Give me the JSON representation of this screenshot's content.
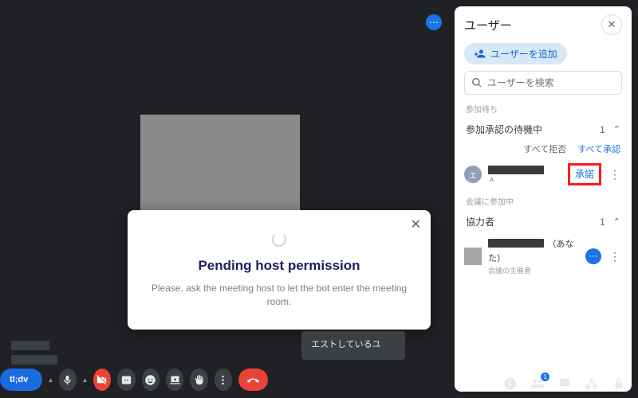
{
  "header_more_label": "⋯",
  "dialog": {
    "title": "Pending host permission",
    "body": "Please, ask the meeting host to let the bot enter the meeting room.",
    "close": "✕"
  },
  "toast": {
    "text": "エストしているユ"
  },
  "controls": {
    "tldv": "tl;dv"
  },
  "panel": {
    "title": "ユーザー",
    "close": "✕",
    "add_user": "ユーザーを追加",
    "search_placeholder": "ユーザーを検索",
    "waiting": {
      "section": "参加待ち",
      "header": "参加承認の待機中",
      "count": "1",
      "deny_all": "すべて拒否",
      "allow_all": "すべて承認",
      "items": [
        {
          "avatar_initial": "エ",
          "approve": "承諾"
        }
      ]
    },
    "in_meeting": {
      "section": "会議に参加中",
      "header": "協力者",
      "count": "1",
      "items": [
        {
          "you_suffix": "（あなた）",
          "role": "会議の主催者"
        }
      ]
    }
  },
  "bottom_right": {
    "people_badge": "1"
  }
}
